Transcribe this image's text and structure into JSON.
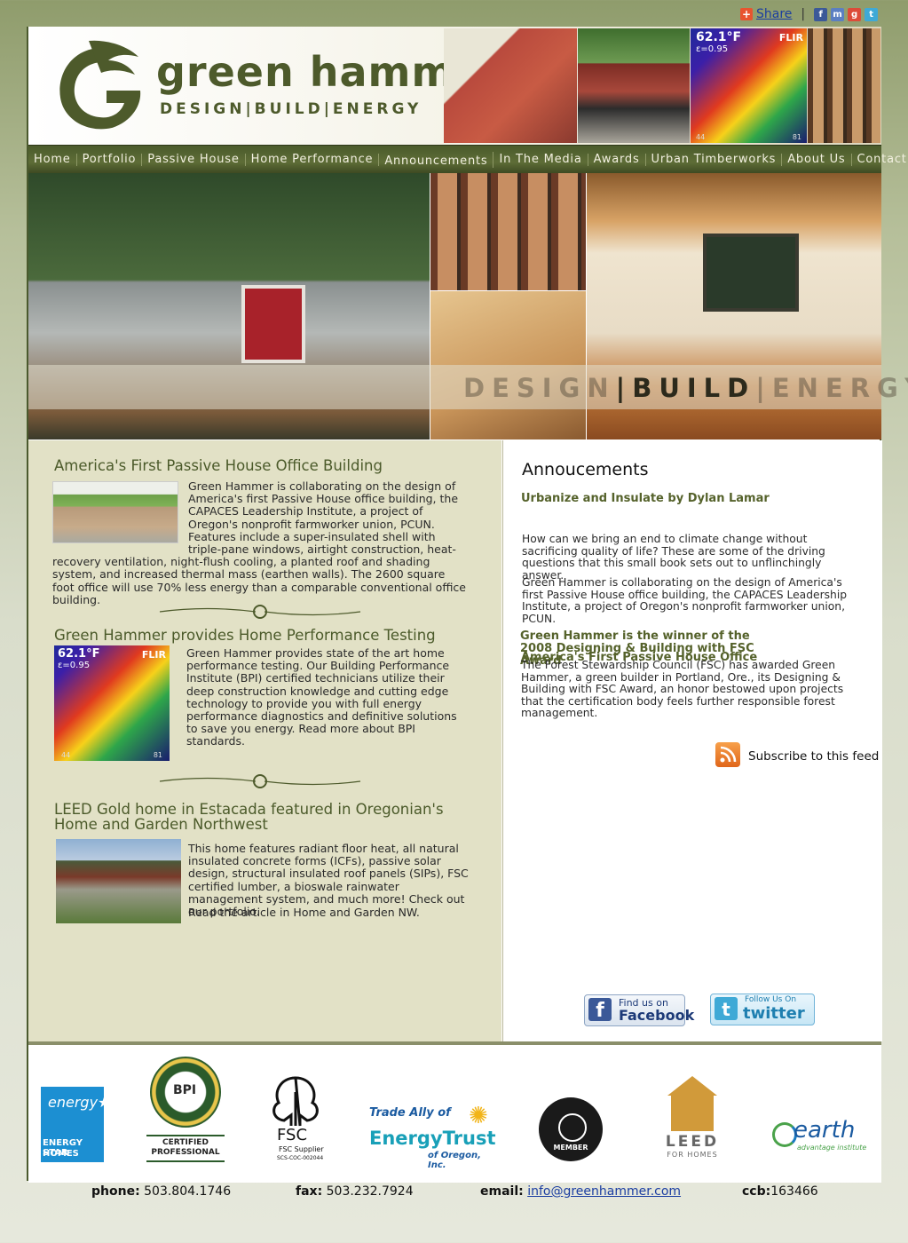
{
  "share": {
    "label": "Share",
    "separator": "|"
  },
  "brand": {
    "name": "green hammer",
    "tagline": "DESIGN|BUILD|ENERGY"
  },
  "header_thermal": {
    "temp": "62.1°F",
    "emissivity": "ε=0.95",
    "brand": "FLIR",
    "scale_low": "44",
    "scale_high": "81"
  },
  "nav": {
    "items": [
      "Home",
      "Portfolio",
      "Passive House",
      "Home Performance",
      "Announcements",
      "In The Media",
      "Awards",
      "Urban Timberworks",
      "About Us",
      "Contact Us"
    ],
    "active": "Announcements"
  },
  "hero": {
    "tag_design": "DESIGN",
    "tag_sep1": "|",
    "tag_build": "BUILD",
    "tag_sep2": "|",
    "tag_energy": "ENERGY"
  },
  "articles": [
    {
      "title": "America's First Passive House Office Building",
      "text": "Green Hammer is collaborating on the design of America's first Passive House office building, the CAPACES Leadership Institute, a project of Oregon's nonprofit farmworker union, PCUN. Features include a super-insulated shell with triple-pane windows, airtight construction, heat-recovery ventilation, night-flush cooling, a planted roof and shading system, and increased thermal mass (earthen walls). The 2600 square foot office will use 70% less energy than a comparable conventional office building."
    },
    {
      "title": "Green Hammer provides Home Performance Testing",
      "text": "Green Hammer provides state of the art home performance testing. Our Building Performance Institute (BPI) certified technicians utilize their deep construction knowledge and cutting edge technology to provide you with full energy performance diagnostics and definitive solutions to save you energy. Read more about BPI standards."
    },
    {
      "title": "LEED Gold home in Estacada featured in Oregonian's Home and Garden Northwest",
      "text": "This home features radiant floor heat, all natural insulated concrete forms (ICFs), passive solar design, structural insulated roof panels (SIPs), FSC certified lumber, a bioswale rainwater management system, and much more! Check out our portfolio.",
      "text2": "Read the article in Home and Garden NW."
    }
  ],
  "announcements": {
    "title": "Annoucements",
    "items": [
      {
        "head": "Urbanize and Insulate by Dylan Lamar",
        "text": "How can we bring an end to climate change without sacrificing quality of life? These are some of the driving questions that this small book sets out to unflinchingly answer."
      },
      {
        "head": "",
        "text": "Green Hammer is collaborating on the design of America's first Passive House office building, the CAPACES Leadership Institute, a project of Oregon's nonprofit farmworker union, PCUN."
      },
      {
        "head": "Green Hammer is the winner of the 2008 Designing & Building with FSC Award",
        "head_overlap": "America's First Passive House Office",
        "text": "The Forest Stewardship Council (FSC) has awarded Green Hammer, a green builder in Portland, Ore., its Designing & Building with FSC Award, an honor bestowed upon projects that the certification body feels further responsible forest management."
      }
    ],
    "subscribe": "Subscribe to this feed"
  },
  "social": {
    "facebook_top": "Find us on",
    "facebook_bottom": "Facebook",
    "twitter_top": "Follow Us On",
    "twitter_bottom": "twitter"
  },
  "logos": {
    "energy_star": [
      "ENERGY STAR",
      "HOMES"
    ],
    "bpi": [
      "BPI",
      "CERTIFIED",
      "PROFESSIONAL"
    ],
    "fsc": [
      "FSC",
      "FSC Supplier",
      "SCS-COC-002044"
    ],
    "energytrust": [
      "Trade Ally of",
      "EnergyTrust",
      "of Oregon, Inc."
    ],
    "usgbc": [
      "MEMBER"
    ],
    "leed": [
      "LEED",
      "FOR HOMES"
    ],
    "earth": [
      "earth",
      "advantage institute"
    ]
  },
  "contact": {
    "phone_label": "phone:",
    "phone": "503.804.1746",
    "fax_label": "fax:",
    "fax": "503.232.7924",
    "email_label": "email:",
    "email": "info@greenhammer.com",
    "ccb_label": "ccb:",
    "ccb": "163466"
  },
  "colors": {
    "brand_green": "#4d5a2b",
    "nav_bg": "#4a5a2b",
    "left_panel": "#e2e1c6",
    "link_blue": "#1a3da1"
  }
}
